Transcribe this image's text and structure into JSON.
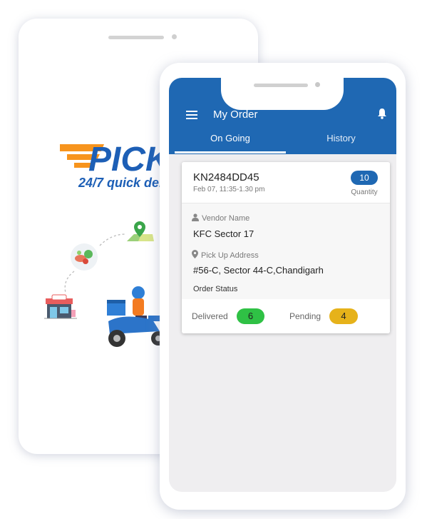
{
  "splash": {
    "logo_text": "PICK",
    "tagline": "24/7 quick del",
    "colors": {
      "brand_blue": "#1d5fb6",
      "brand_orange": "#f7941d"
    },
    "illustrations": [
      "location-pin-icon",
      "fresh-food-icon",
      "shop-icon",
      "delivery-scooter-illustration"
    ]
  },
  "appbar": {
    "title": "My Order",
    "tabs": [
      {
        "label": "On Going",
        "active": true
      },
      {
        "label": "History",
        "active": false
      }
    ],
    "color": "#1f68b3"
  },
  "order": {
    "id": "KN2484DD45",
    "date": "Feb 07, 11:35-1.30 pm",
    "quantity": "10",
    "quantity_label": "Quantity",
    "vendor_label": "Vendor Name",
    "vendor": "KFC Sector 17",
    "pickup_label": "Pick Up Address",
    "pickup": "#56-C, Sector 44-C,Chandigarh",
    "status_label": "Order Status",
    "delivered_label": "Delivered",
    "delivered": "6",
    "pending_label": "Pending",
    "pending": "4",
    "status_colors": {
      "delivered": "#2fc145",
      "pending": "#e6b21a"
    }
  }
}
